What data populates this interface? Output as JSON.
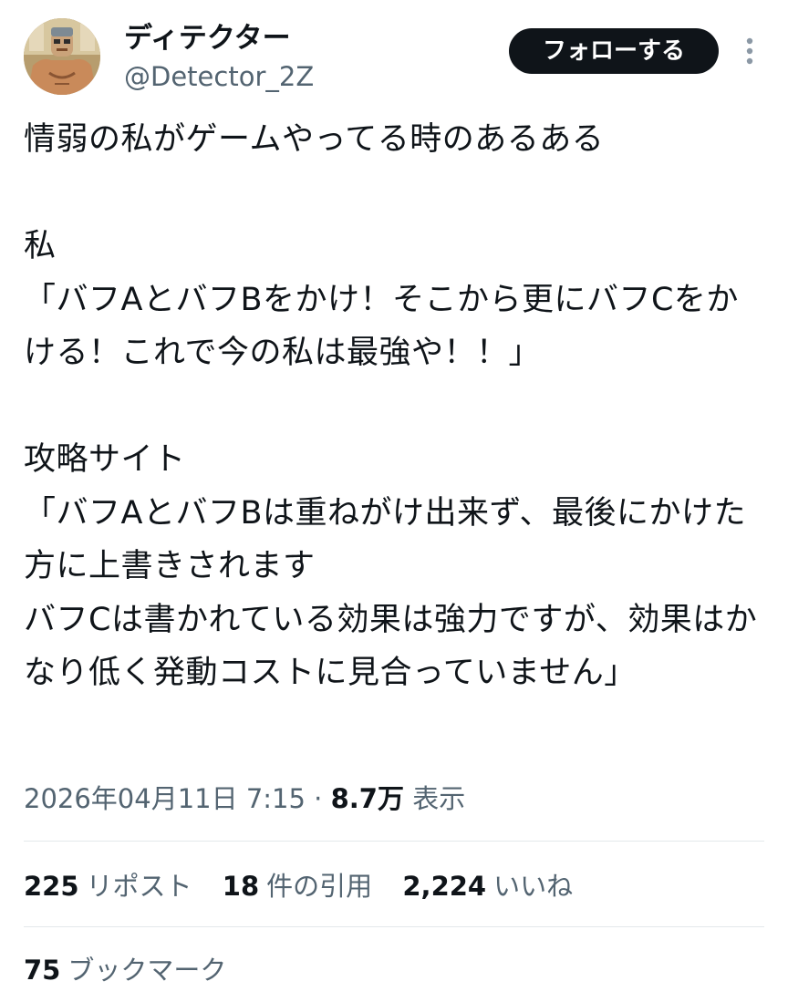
{
  "author": {
    "display_name": "ディテクター",
    "handle": "@Detector_2Z"
  },
  "actions": {
    "follow_label": "フォローする",
    "more_icon": "more-vertical-icon"
  },
  "tweet": {
    "text": "情弱の私がゲームやってる時のあるある\n\n私\n「バフAとバフBをかけ！そこから更にバフCをかける！これで今の私は最強や！！」\n\n攻略サイト\n「バフAとバフBは重ねがけ出来ず、最後にかけた方に上書きされます\nバフCは書かれている効果は強力ですが、効果はかなり低く発動コストに見合っていません」",
    "date": "2026年04月11日 7:15",
    "separator": " · ",
    "views_count": "8.7万",
    "views_label": "表示"
  },
  "stats": {
    "reposts_count": "225",
    "reposts_label": "リポスト",
    "quotes_count": "18",
    "quotes_label": "件の引用",
    "likes_count": "2,224",
    "likes_label": "いいね",
    "bookmarks_count": "75",
    "bookmarks_label": "ブックマーク"
  },
  "colors": {
    "text_primary": "#0f1419",
    "text_secondary": "#536471",
    "follow_button_bg": "#0f1419",
    "divider": "#e4e8eb"
  }
}
